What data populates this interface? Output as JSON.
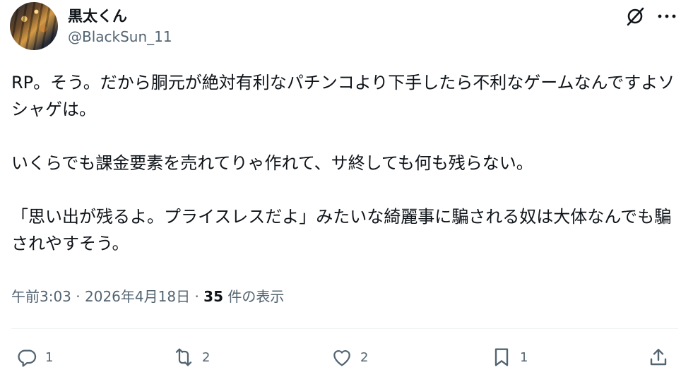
{
  "author": {
    "display_name": "黒太くん",
    "handle": "@BlackSun_11"
  },
  "post": {
    "text": "RP。そう。だから胴元が絶対有利なパチンコより下手したら不利なゲームなんですよソシャゲは。\n\nいくらでも課金要素を売れてりゃ作れて、サ終しても何も残らない。\n\n「思い出が残るよ。プライスレスだよ」みたいな綺麗事に騙される奴は大体なんでも騙されやすそう。"
  },
  "meta": {
    "time": "午前3:03",
    "separator": "·",
    "date": "2026年4月18日",
    "views_count": "35",
    "views_label": "件の表示"
  },
  "actions": {
    "reply_count": "1",
    "repost_count": "2",
    "like_count": "2",
    "bookmark_count": "1"
  },
  "icons": {
    "grok": "grok-icon",
    "more": "more-icon",
    "reply": "reply-icon",
    "repost": "repost-icon",
    "like": "heart-icon",
    "bookmark": "bookmark-icon",
    "share": "share-icon"
  }
}
